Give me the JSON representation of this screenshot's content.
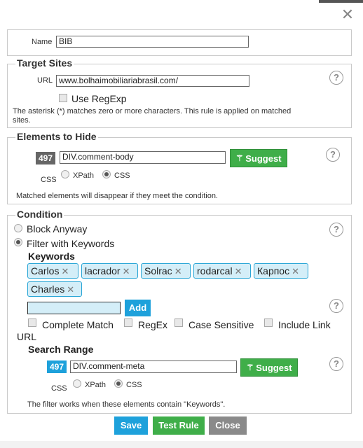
{
  "dialog": {
    "close_icon": "close-icon"
  },
  "name_section": {
    "label": "Name",
    "value": "BIB"
  },
  "target_sites": {
    "legend": "Target Sites",
    "url_label": "URL",
    "url_value": "www.bolhaimobiliariabrasil.com/",
    "use_regexp": "Use RegExp",
    "note_line1": "The asterisk (*) matches zero or more characters. This rule is applied on matched",
    "note_line2": "sites."
  },
  "elements_to_hide": {
    "legend": "Elements to Hide",
    "count": "497",
    "selector": "DIV.comment-body",
    "suggest": "Suggest",
    "type_label": "CSS",
    "xpath": "XPath",
    "css": "CSS",
    "note": "Matched elements will disappear if they meet the condition."
  },
  "condition": {
    "legend": "Condition",
    "block_anyway": "Block Anyway",
    "filter_keywords": "Filter with Keywords",
    "keywords_label": "Keywords",
    "keywords": [
      "Carlos",
      "lacrador",
      "Solrac",
      "rodarcal",
      "Карпос",
      "Charles"
    ],
    "keyword_input": "",
    "add": "Add",
    "complete_match": "Complete Match",
    "regex": "RegEx",
    "case_sensitive": "Case Sensitive",
    "include_link": "Include Link",
    "url": "URL",
    "search_range_label": "Search Range",
    "range_count": "497",
    "range_selector": "DIV.comment-meta",
    "suggest": "Suggest",
    "type_label": "CSS",
    "xpath": "XPath",
    "css": "CSS",
    "note": "The filter works when these elements contain \"Keywords\"."
  },
  "footer": {
    "save": "Save",
    "test_rule": "Test Rule",
    "close": "Close"
  },
  "colors": {
    "green": "#3fae49",
    "blue": "#1ea1db",
    "gray": "#8a8a8a",
    "tag_bg": "#d4eef8",
    "tag_border": "#2aa6d6"
  }
}
